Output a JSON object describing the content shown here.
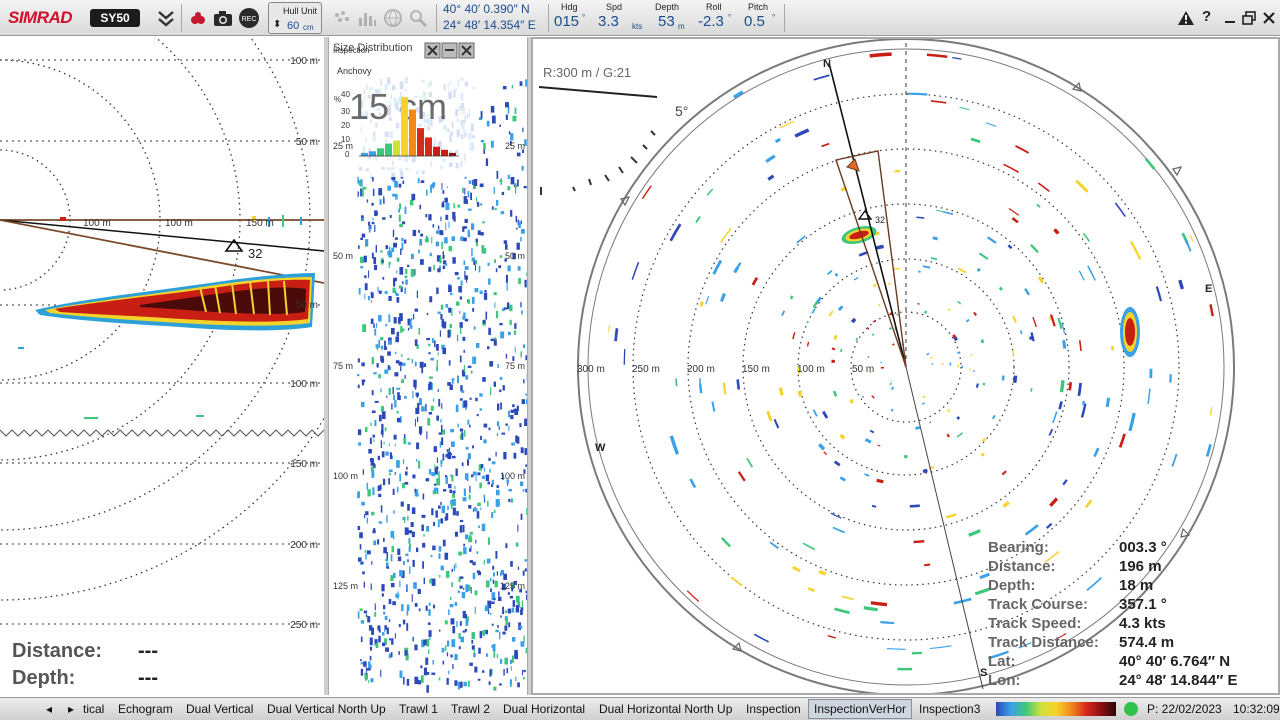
{
  "app": {
    "brand": "SIMRAD",
    "model": "SY50"
  },
  "toolbar": {
    "hull_unit_label": "Hull Unit",
    "hull_unit_value": "60",
    "hull_unit_unit": "cm",
    "rec_label": "REC",
    "position": {
      "lat": "40° 40′ 0.390″ N",
      "lon": "24° 48′ 14.354″ E"
    },
    "nav": [
      {
        "label": "Hdg",
        "value": "015",
        "unit": "°"
      },
      {
        "label": "Spd",
        "value": "3.3",
        "unit": "kts"
      },
      {
        "label": "Depth",
        "value": "53",
        "unit": "m"
      },
      {
        "label": "Roll",
        "value": "-2.3",
        "unit": "°"
      },
      {
        "label": "Pitch",
        "value": "0.5",
        "unit": "°"
      }
    ],
    "icons": [
      "collapse-chevrons-icon",
      "fish-icon",
      "camera-icon",
      "record-icon",
      "fish-school-icon",
      "histogram-icon",
      "globe-icon",
      "zoom-icon",
      "warning-icon",
      "help-icon",
      "minimize-icon",
      "restore-icon",
      "close-icon"
    ]
  },
  "left_panel": {
    "range_labels": [
      "100 m",
      "50 m",
      "50 m",
      "100 m",
      "150 m",
      "200 m",
      "250 m"
    ],
    "horizontal_labels": [
      "100 m",
      "100 m",
      "150 m"
    ],
    "target_number": "32",
    "distance_label": "Distance:",
    "distance_value": "---",
    "depth_label": "Depth:",
    "depth_value": "---"
  },
  "middle_panel": {
    "overlay_title": "Size Distribution",
    "sub_title": "Inspection",
    "species": "Anchovy",
    "size": "15 cm",
    "y_axis": [
      "%",
      "40",
      "30",
      "20",
      "10",
      "0"
    ],
    "depth_labels": [
      "25 m",
      "50 m",
      "75 m",
      "100 m",
      "125 m"
    ],
    "depth_labels_right": [
      "25 m",
      "50 m",
      "75 m",
      "100 m",
      "125 m"
    ],
    "histogram_values": [
      2,
      3,
      5,
      8,
      10,
      38,
      30,
      18,
      12,
      6,
      4,
      2
    ]
  },
  "right_panel": {
    "range_gain": "R:300 m  / G:21",
    "tilt_label": "5°",
    "compass": [
      "N",
      "E",
      "S",
      "W"
    ],
    "range_labels": [
      "300 m",
      "250 m",
      "200 m",
      "150 m",
      "100 m",
      "50 m"
    ],
    "target_number": "32",
    "info": [
      {
        "label": "Bearing:",
        "value": "003.3 °"
      },
      {
        "label": "Distance:",
        "value": "196 m"
      },
      {
        "label": "Depth:",
        "value": "18 m"
      },
      {
        "label": "Track Course:",
        "value": "357.1 °"
      },
      {
        "label": "Track Speed:",
        "value": "4.3 kts"
      },
      {
        "label": "Track Distance:",
        "value": "574.4 m"
      },
      {
        "label": "Lat:",
        "value": "40° 40′ 6.764″ N"
      },
      {
        "label": "Lon:",
        "value": "24° 48′ 14.844″ E"
      }
    ]
  },
  "bottom_bar": {
    "tabs": [
      "tical",
      "Echogram",
      "Dual Vertical",
      "Dual Vertical North Up",
      "Trawl 1",
      "Trawl 2",
      "Dual Horizontal",
      "Dual Horizontal North Up",
      "Inspection",
      "InspectionVerHor",
      "Inspection3"
    ],
    "active_tab": "InspectionVerHor",
    "date": "P: 22/02/2023",
    "time": "10:32:09"
  },
  "colors": {
    "brand_red": "#d0102a",
    "value_blue": "#1a4d8c",
    "echo_red": "#c81e14",
    "echo_dark": "#4a0a0a"
  }
}
